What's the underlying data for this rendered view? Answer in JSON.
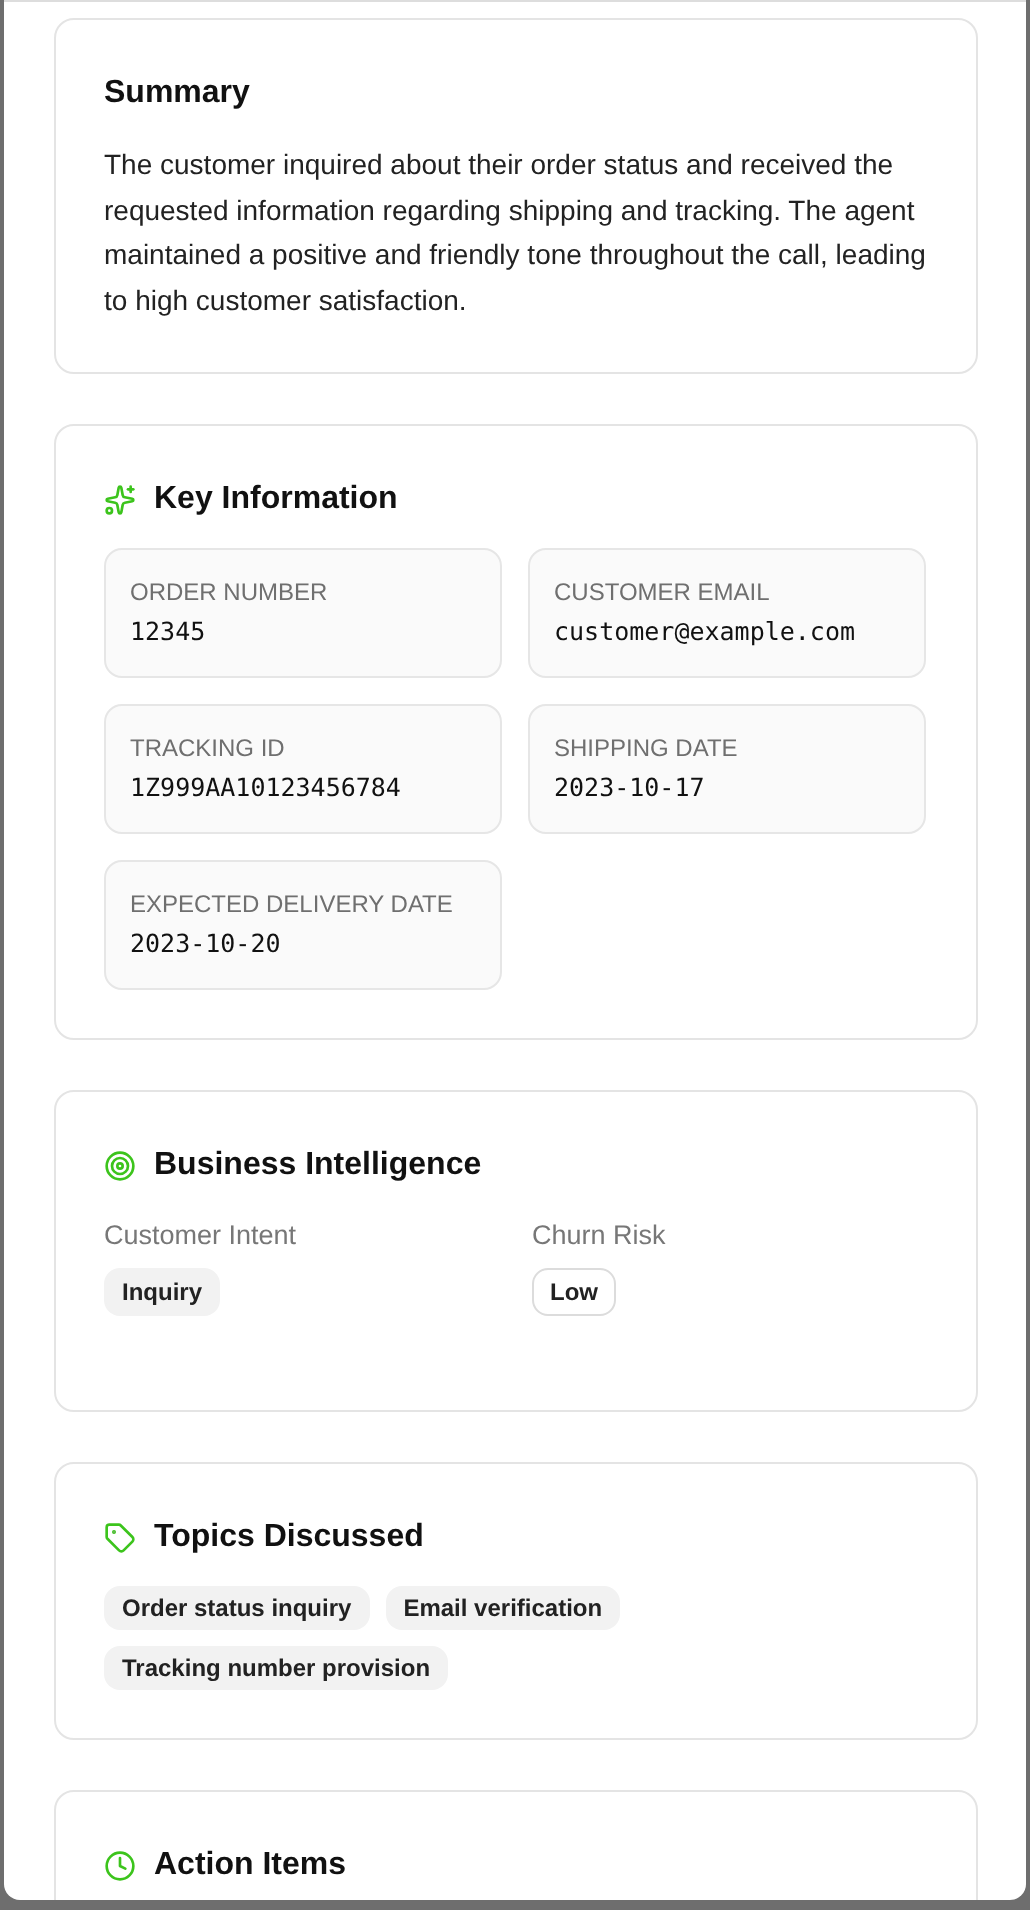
{
  "sections": [
    {
      "kind": "summary",
      "title": "Summary",
      "text": "The customer inquired about their order status and received the requested information regarding shipping and tracking. The agent maintained a positive and friendly tone throughout the call, leading to high customer satisfaction."
    },
    {
      "kind": "key_info",
      "title": "Key Information",
      "fields": [
        {
          "label": "ORDER NUMBER",
          "value": "12345"
        },
        {
          "label": "CUSTOMER EMAIL",
          "value": "customer@example.com"
        },
        {
          "label": "TRACKING ID",
          "value": "1Z999AA10123456784"
        },
        {
          "label": "SHIPPING DATE",
          "value": "2023-10-17"
        },
        {
          "label": "EXPECTED DELIVERY DATE",
          "value": "2023-10-20"
        }
      ]
    },
    {
      "kind": "intelligence",
      "title": "Business Intelligence",
      "metrics": [
        {
          "label": "Customer Intent",
          "badge": "Inquiry",
          "kind": "filled"
        },
        {
          "label": "Churn Risk",
          "badge": "Low",
          "kind": "outline"
        }
      ]
    },
    {
      "kind": "topics",
      "title": "Topics Discussed",
      "topics": [
        "Order status inquiry",
        "Email verification",
        "Tracking number provision"
      ]
    },
    {
      "kind": "actions",
      "title": "Action Items"
    }
  ]
}
